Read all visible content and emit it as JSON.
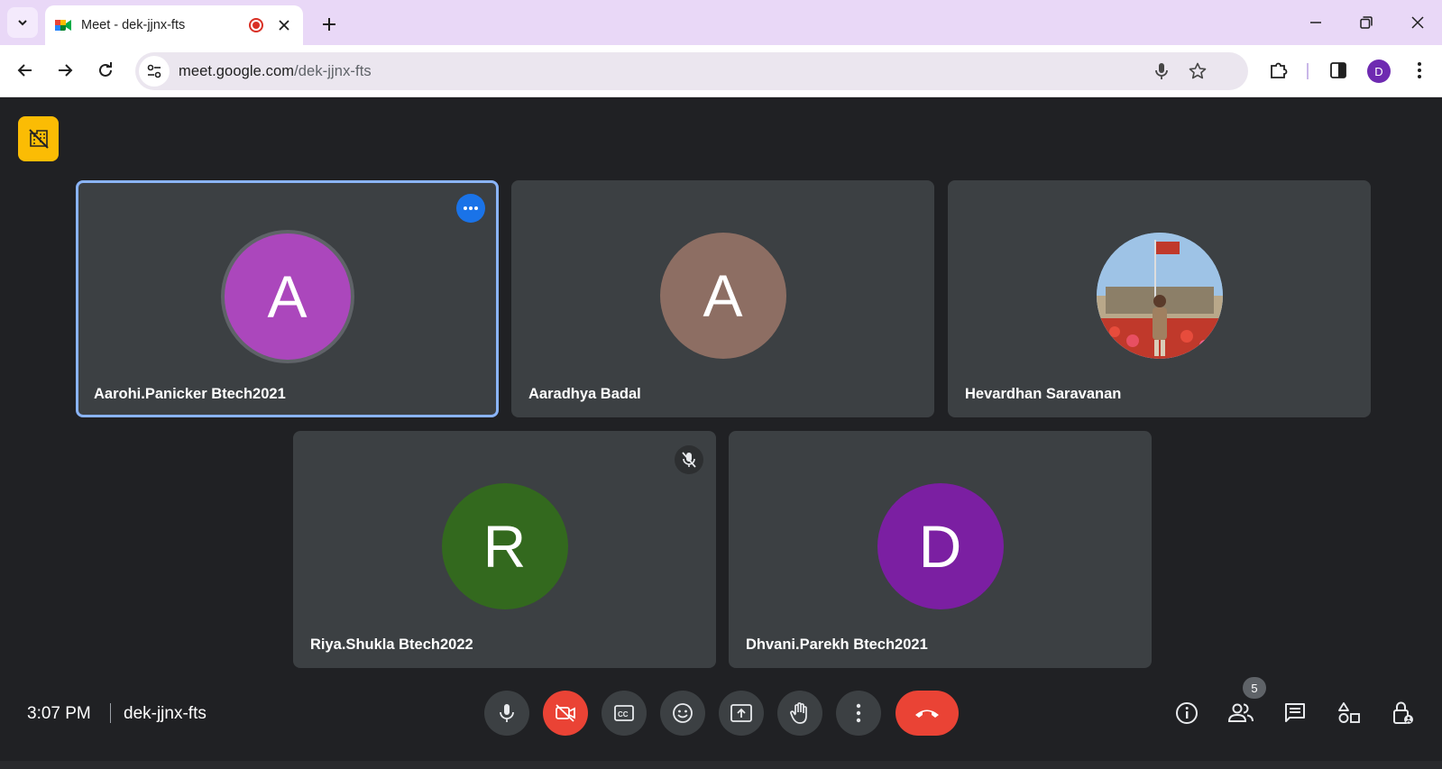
{
  "browser": {
    "tab_title": "Meet - dek-jjnx-fts",
    "url_host": "meet.google.com",
    "url_path": "/dek-jjnx-fts",
    "profile_initial": "D"
  },
  "meet": {
    "participants": [
      {
        "name": "Aarohi.Panicker Btech2021",
        "initial": "A",
        "color": "#ab47bc",
        "active": true
      },
      {
        "name": "Aaradhya Badal",
        "initial": "A",
        "color": "#8d6e63"
      },
      {
        "name": "Hevardhan Saravanan",
        "initial": "",
        "photo": true
      },
      {
        "name": "Riya.Shukla Btech2022",
        "initial": "R",
        "color": "#33691e",
        "muted": true
      },
      {
        "name": "Dhvani.Parekh Btech2021",
        "initial": "D",
        "color": "#7b1fa2"
      }
    ],
    "time": "3:07 PM",
    "meeting_code": "dek-jjnx-fts",
    "people_count": "5",
    "controls": [
      "mic-icon",
      "camera-off-icon",
      "captions-icon",
      "emoji-icon",
      "present-screen-icon",
      "raise-hand-icon",
      "more-options-icon",
      "end-call-icon"
    ],
    "right_panel": [
      "info-icon",
      "people-icon",
      "chat-icon",
      "activities-icon",
      "host-controls-icon"
    ]
  }
}
